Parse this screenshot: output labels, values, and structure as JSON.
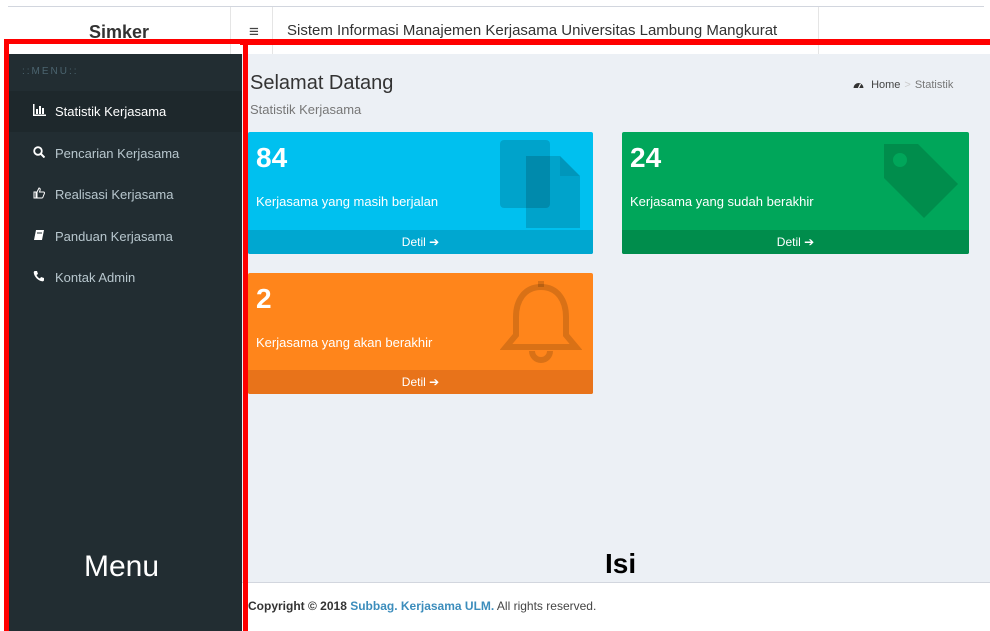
{
  "header": {
    "logo": "Simker",
    "hamburger": "≡",
    "title": "Sistem Informasi Manajemen Kerjasama Universitas Lambung Mangkurat"
  },
  "sidebar": {
    "header": "::MENU::",
    "items": [
      {
        "label": "Statistik Kerjasama",
        "icon": "▓"
      },
      {
        "label": "Pencarian Kerjasama",
        "icon": "⌕"
      },
      {
        "label": "Realisasi Kerjasama",
        "icon": "☝"
      },
      {
        "label": "Panduan Kerjasama",
        "icon": "■"
      },
      {
        "label": "Kontak Admin",
        "icon": "☎"
      }
    ]
  },
  "content": {
    "title": "Selamat Datang",
    "subtitle": "Statistik Kerjasama",
    "breadcrumb": {
      "home": "Home",
      "separator": ">",
      "current": "Statistik"
    },
    "boxes": [
      {
        "number": "84",
        "label": "Kerjasama yang masih berjalan",
        "footer": "Detil ➔",
        "color": "#00c0ef",
        "icon": "copy-icon"
      },
      {
        "number": "24",
        "label": "Kerjasama yang sudah berakhir",
        "footer": "Detil ➔",
        "color": "#00a65a",
        "icon": "tag-icon"
      },
      {
        "number": "2",
        "label": "Kerjasama yang akan berakhir",
        "footer": "Detil ➔",
        "color": "#ff851b",
        "icon": "bell-icon"
      }
    ]
  },
  "footer": {
    "prefix": "Copyright © 2018 ",
    "link": "Subbag. Kerjasama ULM.",
    "suffix": " All rights reserved."
  },
  "annotations": {
    "menu": "Menu",
    "isi": "Isi"
  }
}
